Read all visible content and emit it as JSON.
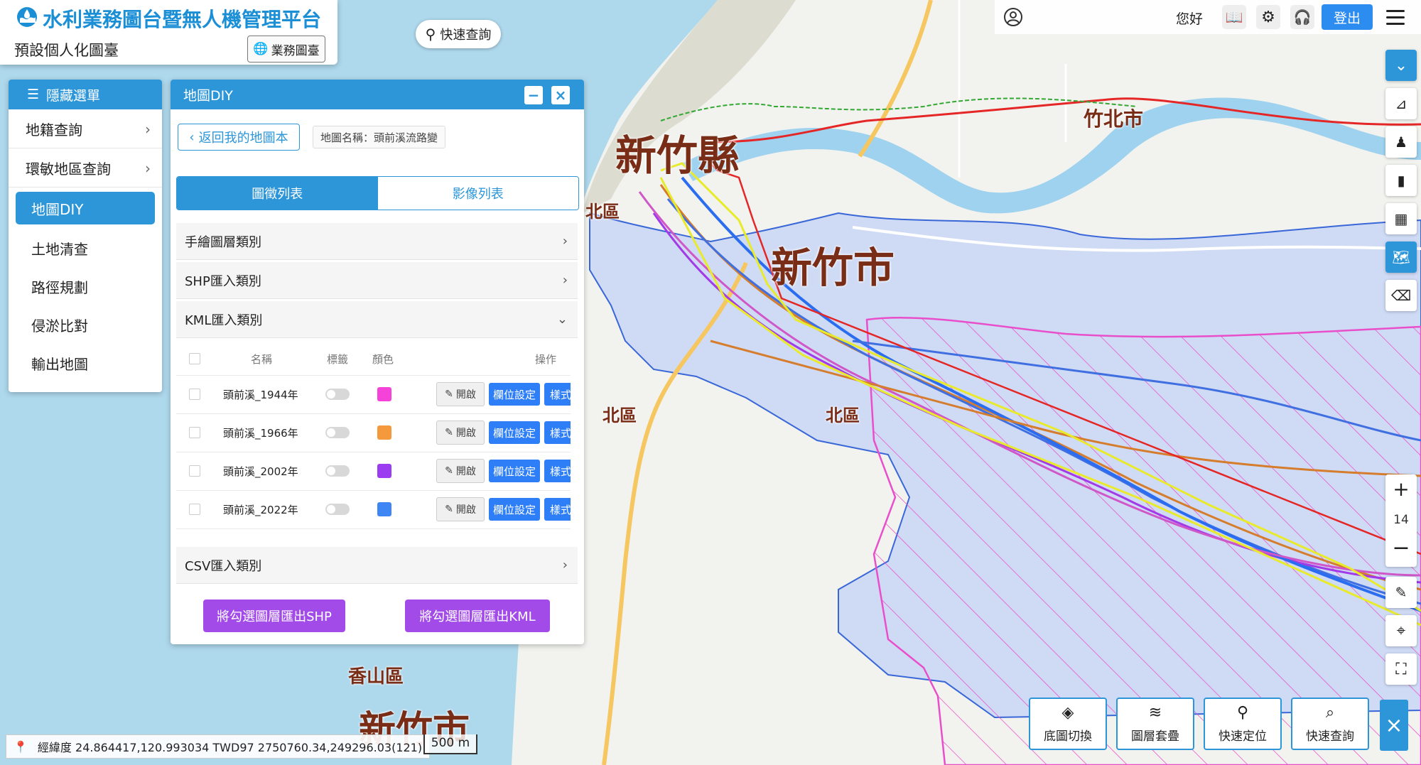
{
  "header": {
    "app_title": "水利業務圖台暨無人機管理平台",
    "preset_label": "預設個人化圖臺",
    "business_btn": "業務圖臺",
    "quick_search": "快速查詢"
  },
  "topbar": {
    "greeting": "您好",
    "login": "登出"
  },
  "menu": {
    "title": "隱藏選單",
    "items": [
      {
        "label": "地籍查詢",
        "has_submenu": true
      },
      {
        "label": "環敏地區查詢",
        "has_submenu": true
      },
      {
        "label": "地圖DIY",
        "active": true
      },
      {
        "label": "土地清查"
      },
      {
        "label": "路徑規劃"
      },
      {
        "label": "侵淤比對"
      },
      {
        "label": "輸出地圖"
      }
    ]
  },
  "diy": {
    "title": "地圖DIY",
    "back": "返回我的地圖本",
    "map_name": "地圖名稱：頭前溪流路變",
    "tabs": [
      "圖徵列表",
      "影像列表"
    ],
    "categories": [
      "手繪圖層類別",
      "SHP匯入類別",
      "KML匯入類別",
      "CSV匯入類別"
    ],
    "table": {
      "headers": [
        "名稱",
        "標籤",
        "顏色",
        "操作"
      ],
      "rows": [
        {
          "name": "頭前溪_1944年",
          "color": "#f542d8"
        },
        {
          "name": "頭前溪_1966年",
          "color": "#f59a3c"
        },
        {
          "name": "頭前溪_2002年",
          "color": "#9b3cf0"
        },
        {
          "name": "頭前溪_2022年",
          "color": "#3f86f5"
        }
      ],
      "btn_open": "開啟",
      "btn_field": "欄位設定",
      "btn_style": "樣式"
    },
    "export_shp": "將勾選圖層匯出SHP",
    "export_kml": "將勾選圖層匯出KML"
  },
  "map": {
    "labels": {
      "hsinchu_county": "新竹縣",
      "hsinchu_city": "新竹市",
      "hsinchu_city_bottom": "新竹市",
      "zhubei": "竹北市",
      "north_district": "北區",
      "north_district_2": "北區",
      "north_district_3": "北區",
      "xiangshan": "香山區"
    },
    "zoom_level": "14",
    "scale": "500 m",
    "coords": "經緯度  24.864417,120.993034  TWD97  2750760.34,249296.03(121)"
  },
  "bottom_tools": [
    "底圖切換",
    "圖層套疊",
    "快速定位",
    "快速查詢"
  ],
  "colors": {
    "primary": "#2c96d9",
    "purple": "#a34be8",
    "blue_btn": "#2d7ef7"
  }
}
